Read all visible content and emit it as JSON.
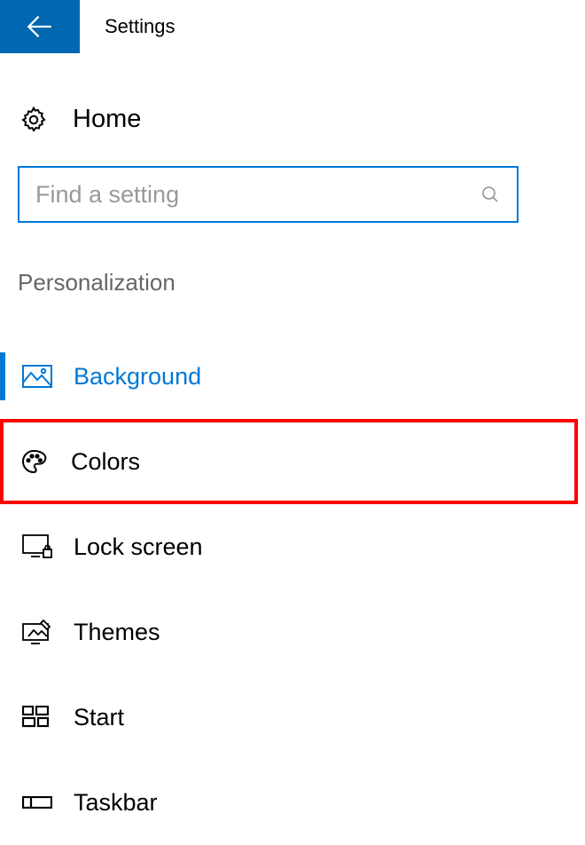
{
  "title": "Settings",
  "home_label": "Home",
  "search": {
    "placeholder": "Find a setting"
  },
  "section": "Personalization",
  "nav": {
    "background": "Background",
    "colors": "Colors",
    "lock_screen": "Lock screen",
    "themes": "Themes",
    "start": "Start",
    "taskbar": "Taskbar"
  }
}
